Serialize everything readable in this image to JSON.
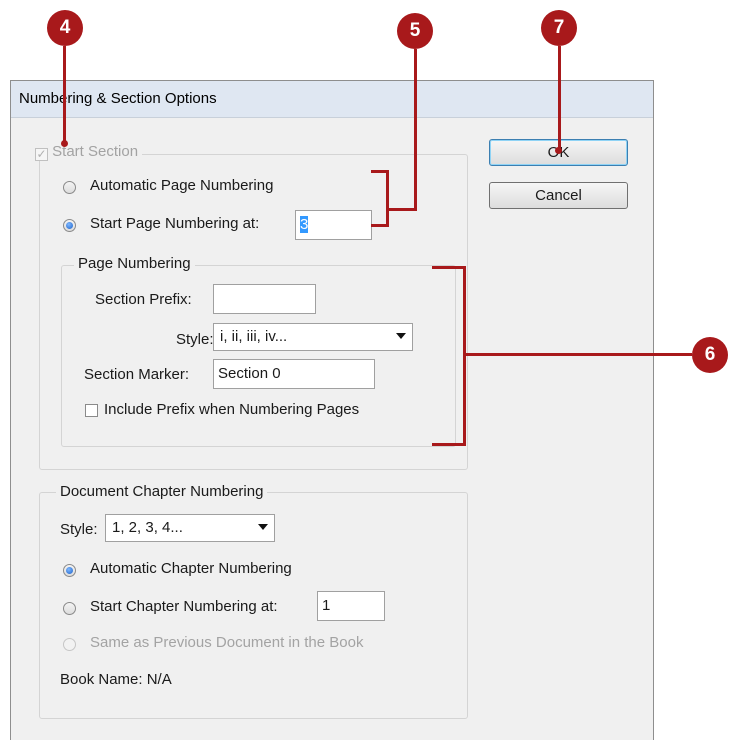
{
  "dialog": {
    "title": "Numbering & Section Options",
    "ok_label": "OK",
    "cancel_label": "Cancel"
  },
  "section": {
    "start_section_label": "Start Section",
    "start_section_checked": true,
    "automatic_page_numbering_label": "Automatic Page Numbering",
    "start_page_numbering_label": "Start Page Numbering at:",
    "start_page_number": "3",
    "selected_option": "start_page_numbering"
  },
  "page_numbering": {
    "group_label": "Page Numbering",
    "section_prefix_label": "Section Prefix:",
    "section_prefix_value": "",
    "style_label": "Style:",
    "style_value": "i, ii, iii, iv...",
    "section_marker_label": "Section Marker:",
    "section_marker_value": "Section 0",
    "include_prefix_label": "Include Prefix when Numbering Pages",
    "include_prefix_checked": false
  },
  "chapter_numbering": {
    "group_label": "Document Chapter Numbering",
    "style_label": "Style:",
    "style_value": "1, 2, 3, 4...",
    "automatic_chapter_label": "Automatic Chapter Numbering",
    "start_chapter_label": "Start Chapter Numbering at:",
    "start_chapter_value": "1",
    "same_as_previous_label": "Same as Previous Document in the Book",
    "book_name_label": "Book Name: N/A",
    "selected_option": "automatic_chapter_numbering"
  },
  "callouts": {
    "c4": "4",
    "c5": "5",
    "c6": "6",
    "c7": "7",
    "color": "#a8191b"
  }
}
